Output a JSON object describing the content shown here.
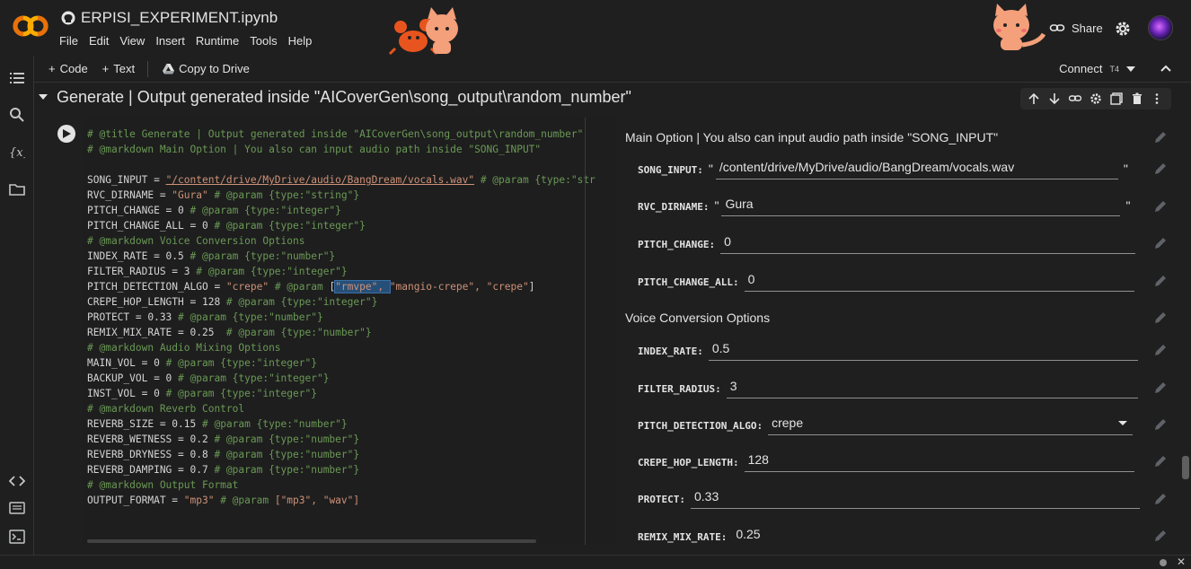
{
  "app": {
    "logo_text": "CO",
    "title": "ERPISI_EXPERIMENT.ipynb",
    "menu": [
      "File",
      "Edit",
      "View",
      "Insert",
      "Runtime",
      "Tools",
      "Help"
    ],
    "share_label": "Share"
  },
  "toolbar": {
    "code_label": "Code",
    "text_label": "Text",
    "copy_to_drive_label": "Copy to Drive",
    "connect_label": "Connect",
    "runtime_badge": "T4"
  },
  "cell": {
    "title": "Generate | Output generated inside \"AICoverGen\\song_output\\random_number\"",
    "code_lines": [
      [
        {
          "c": "cm",
          "t": "# @title Generate | Output generated inside \"AICoverGen\\song_output\\random_number\""
        }
      ],
      [
        {
          "c": "cm",
          "t": "# @markdown Main Option | You also can input audio path inside \"SONG_INPUT\""
        }
      ],
      [
        {
          "c": "",
          "t": ""
        }
      ],
      [
        {
          "c": "",
          "t": "SONG_INPUT = "
        },
        {
          "c": "st ul",
          "t": "\"/content/drive/MyDrive/audio/BangDream/vocals.wav\""
        },
        {
          "c": "cm",
          "t": " # @param {type:\"str"
        }
      ],
      [
        {
          "c": "",
          "t": "RVC_DIRNAME = "
        },
        {
          "c": "st",
          "t": "\"Gura\""
        },
        {
          "c": "cm",
          "t": " # @param {type:\"string\"}"
        }
      ],
      [
        {
          "c": "",
          "t": "PITCH_CHANGE = 0 "
        },
        {
          "c": "cm",
          "t": "# @param {type:\"integer\"}"
        }
      ],
      [
        {
          "c": "",
          "t": "PITCH_CHANGE_ALL = 0 "
        },
        {
          "c": "cm",
          "t": "# @param {type:\"integer\"}"
        }
      ],
      [
        {
          "c": "cm",
          "t": "# @markdown Voice Conversion Options"
        }
      ],
      [
        {
          "c": "",
          "t": "INDEX_RATE = 0.5 "
        },
        {
          "c": "cm",
          "t": "# @param {type:\"number\"}"
        }
      ],
      [
        {
          "c": "",
          "t": "FILTER_RADIUS = 3 "
        },
        {
          "c": "cm",
          "t": "# @param {type:\"integer\"}"
        }
      ],
      [
        {
          "c": "",
          "t": "PITCH_DETECTION_ALGO = "
        },
        {
          "c": "st",
          "t": "\"crepe\""
        },
        {
          "c": "cm",
          "t": " # @param "
        },
        {
          "c": "",
          "t": "["
        },
        {
          "c": "st hl",
          "t": "\"rmvpe\", "
        },
        {
          "c": "st",
          "t": "\"mangio-crepe\", \"crepe\""
        },
        {
          "c": "",
          "t": "]"
        }
      ],
      [
        {
          "c": "",
          "t": "CREPE_HOP_LENGTH = 128 "
        },
        {
          "c": "cm",
          "t": "# @param {type:\"integer\"}"
        }
      ],
      [
        {
          "c": "",
          "t": "PROTECT = 0.33 "
        },
        {
          "c": "cm",
          "t": "# @param {type:\"number\"}"
        }
      ],
      [
        {
          "c": "",
          "t": "REMIX_MIX_RATE = 0.25  "
        },
        {
          "c": "cm",
          "t": "# @param {type:\"number\"}"
        }
      ],
      [
        {
          "c": "cm",
          "t": "# @markdown Audio Mixing Options"
        }
      ],
      [
        {
          "c": "",
          "t": "MAIN_VOL = 0 "
        },
        {
          "c": "cm",
          "t": "# @param {type:\"integer\"}"
        }
      ],
      [
        {
          "c": "",
          "t": "BACKUP_VOL = 0 "
        },
        {
          "c": "cm",
          "t": "# @param {type:\"integer\"}"
        }
      ],
      [
        {
          "c": "",
          "t": "INST_VOL = 0 "
        },
        {
          "c": "cm",
          "t": "# @param {type:\"integer\"}"
        }
      ],
      [
        {
          "c": "cm",
          "t": "# @markdown Reverb Control"
        }
      ],
      [
        {
          "c": "",
          "t": "REVERB_SIZE = 0.15 "
        },
        {
          "c": "cm",
          "t": "# @param {type:\"number\"}"
        }
      ],
      [
        {
          "c": "",
          "t": "REVERB_WETNESS = 0.2 "
        },
        {
          "c": "cm",
          "t": "# @param {type:\"number\"}"
        }
      ],
      [
        {
          "c": "",
          "t": "REVERB_DRYNESS = 0.8 "
        },
        {
          "c": "cm",
          "t": "# @param {type:\"number\"}"
        }
      ],
      [
        {
          "c": "",
          "t": "REVERB_DAMPING = 0.7 "
        },
        {
          "c": "cm",
          "t": "# @param {type:\"number\"}"
        }
      ],
      [
        {
          "c": "cm",
          "t": "# @markdown Output Format"
        }
      ],
      [
        {
          "c": "",
          "t": "OUTPUT_FORMAT = "
        },
        {
          "c": "st",
          "t": "\"mp3\""
        },
        {
          "c": "cm",
          "t": " # @param "
        },
        {
          "c": "st",
          "t": "[\"mp3\", \"wav\"]"
        }
      ]
    ]
  },
  "form": {
    "section_main": "Main Option | You also can input audio path inside \"SONG_INPUT\"",
    "section_voice": "Voice Conversion Options",
    "quote": "\"",
    "fields": {
      "song_input": {
        "label": "SONG_INPUT:",
        "value": "/content/drive/MyDrive/audio/BangDream/vocals.wav"
      },
      "rvc_dirname": {
        "label": "RVC_DIRNAME:",
        "value": "Gura"
      },
      "pitch_change": {
        "label": "PITCH_CHANGE:",
        "value": "0"
      },
      "pitch_change_all": {
        "label": "PITCH_CHANGE_ALL:",
        "value": "0"
      },
      "index_rate": {
        "label": "INDEX_RATE:",
        "value": "0.5"
      },
      "filter_radius": {
        "label": "FILTER_RADIUS:",
        "value": "3"
      },
      "pitch_detection_algo": {
        "label": "PITCH_DETECTION_ALGO:",
        "value": "crepe"
      },
      "crepe_hop_length": {
        "label": "CREPE_HOP_LENGTH:",
        "value": "128"
      },
      "protect": {
        "label": "PROTECT:",
        "value": "0.33"
      },
      "remix_mix_rate": {
        "label": "REMIX_MIX_RATE:",
        "value": "0.25"
      }
    }
  },
  "colors": {
    "accent_orange": "#f9ab00",
    "comment_green": "#6a9955",
    "string_orange": "#ce9178",
    "background": "#1f1f1f"
  }
}
